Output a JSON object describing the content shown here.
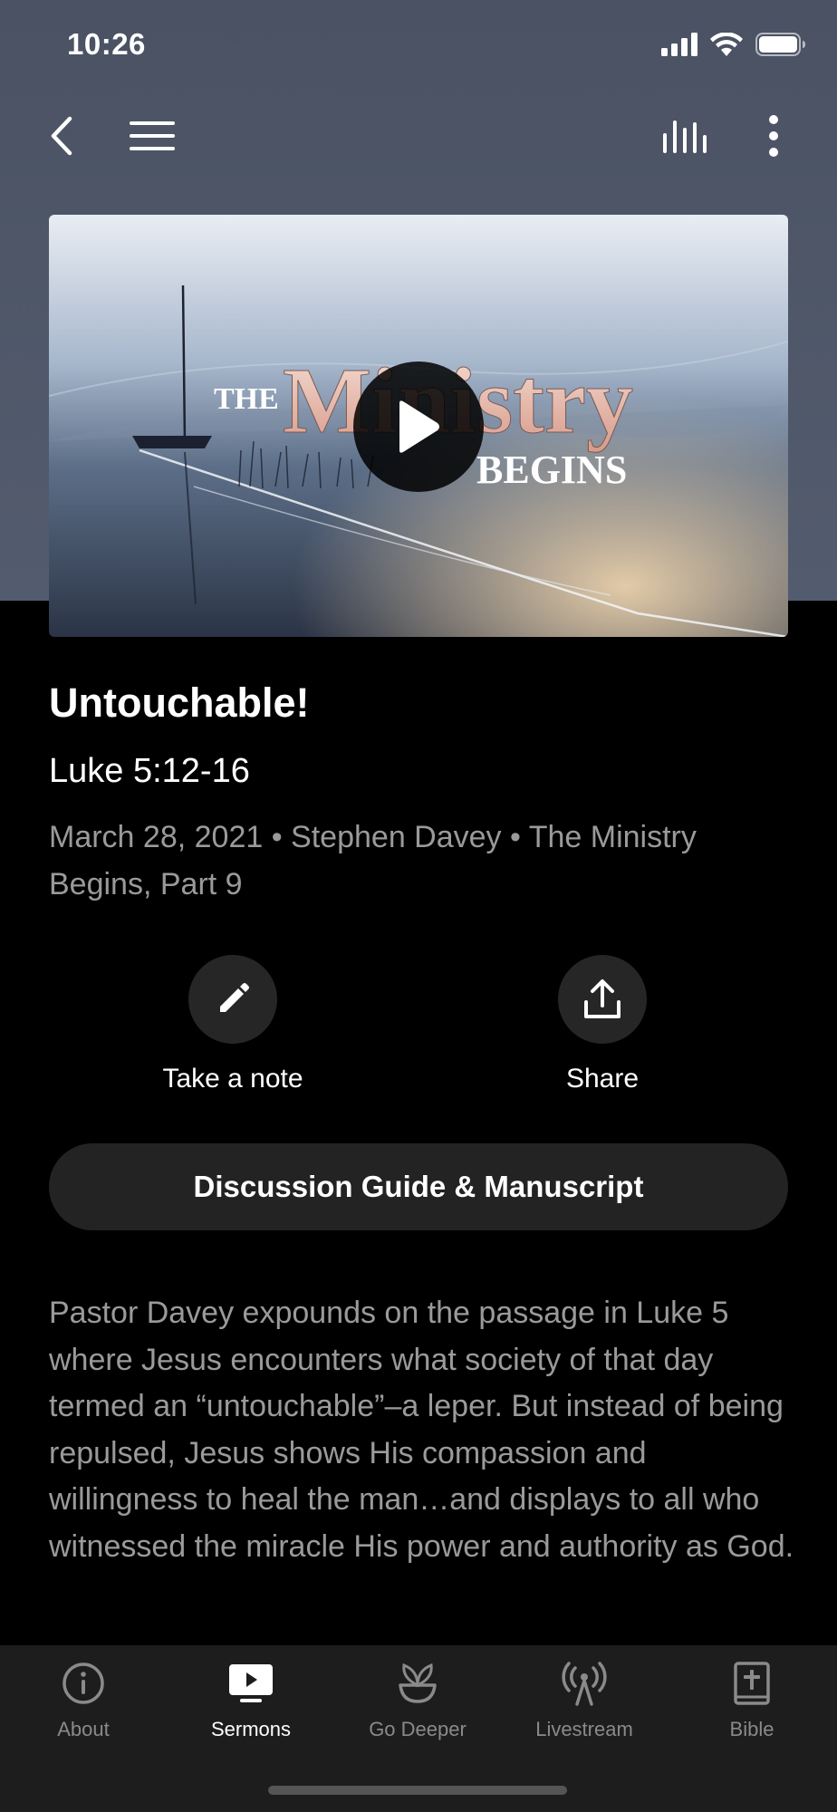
{
  "status_bar": {
    "time": "10:26"
  },
  "nav": {
    "back_icon": "chevron-left-icon",
    "menu_icon": "hamburger-menu-icon",
    "audio_icon": "audio-bars-icon",
    "more_icon": "more-vertical-icon"
  },
  "hero": {
    "artwork_line1": "THE",
    "artwork_line2": "Ministry",
    "artwork_line3": "BEGINS",
    "play_icon": "play-icon"
  },
  "sermon": {
    "title": "Untouchable!",
    "scripture": "Luke 5:12-16",
    "meta": "March 28, 2021 • Stephen Davey • The Ministry Begins, Part 9"
  },
  "actions": {
    "note_label": "Take a note",
    "share_label": "Share"
  },
  "guide_button_label": "Discussion Guide & Manuscript",
  "description": "Pastor Davey expounds on the passage in Luke 5 where Jesus encounters what society of that day termed an “untouchable”–a leper. But instead of being repulsed, Jesus shows His compassion and willingness to heal the man…and displays to all who witnessed the miracle His power and authority as God.",
  "tabs": [
    {
      "label": "About",
      "icon": "info-icon",
      "active": false
    },
    {
      "label": "Sermons",
      "icon": "tv-play-icon",
      "active": true
    },
    {
      "label": "Go Deeper",
      "icon": "plant-pot-icon",
      "active": false
    },
    {
      "label": "Livestream",
      "icon": "broadcast-icon",
      "active": false
    },
    {
      "label": "Bible",
      "icon": "bible-icon",
      "active": false
    }
  ],
  "colors": {
    "header_bg": "#4f5869",
    "page_bg": "#000000",
    "muted_text": "#9a9a9a",
    "button_bg": "#232323",
    "tab_bar_bg": "#1d1d1d"
  }
}
